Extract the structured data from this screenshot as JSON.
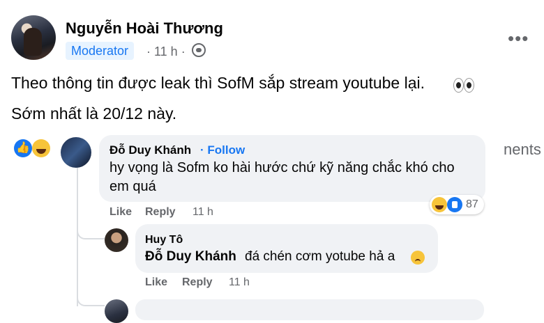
{
  "post": {
    "author": "Nguyễn Hoài Thương",
    "badge": "Moderator",
    "time": "· 11 h ·",
    "line1": "Theo thông tin được leak thì SofM sắp stream youtube lại.",
    "line2": "Sớm nhất là 20/12 này.",
    "comments_label": "nents"
  },
  "comments": [
    {
      "author": "Đỗ Duy Khánh",
      "follow": "· Follow",
      "line1": "hy vọng là Sofm ko hài hước chứ kỹ năng chắc khó cho",
      "line2": "em quá",
      "reaction_count": "87",
      "like": "Like",
      "reply": "Reply",
      "time": "11 h"
    },
    {
      "author": "Huy Tô",
      "mention": "Đỗ Duy Khánh",
      "text": "đá chén cơm yotube hả a",
      "like": "Like",
      "reply": "Reply",
      "time": "11 h"
    }
  ],
  "colors": {
    "accent": "#1877f2",
    "bubble": "#f0f2f5",
    "muted": "#65676b"
  }
}
